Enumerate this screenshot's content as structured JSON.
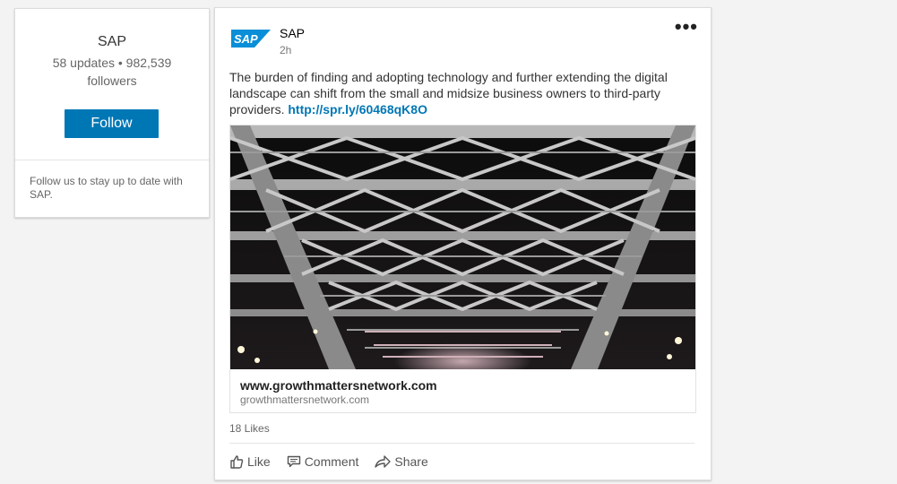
{
  "company": {
    "name": "SAP",
    "stats": "58 updates • 982,539 followers",
    "follow_label": "Follow",
    "blurb": "Follow us to stay up to date with SAP."
  },
  "post": {
    "author": "SAP",
    "logo_text": "SAP",
    "time": "2h",
    "more_label": "•••",
    "text": "The burden of finding and adopting technology and further extending the digital landscape can shift from the small and midsize business owners to third-party providers.",
    "link": "http://spr.ly/60468qK8O",
    "preview": {
      "title": "www.growthmattersnetwork.com",
      "domain": "growthmattersnetwork.com"
    },
    "likes": "18 Likes",
    "actions": {
      "like": "Like",
      "comment": "Comment",
      "share": "Share"
    }
  },
  "colors": {
    "brand": "#0077b5",
    "sap_logo": "#0a8ed8"
  }
}
